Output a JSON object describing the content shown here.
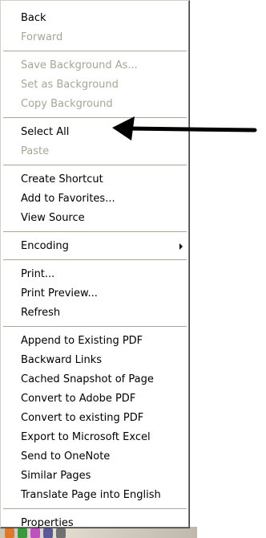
{
  "menu": {
    "groups": [
      [
        {
          "label": "Back",
          "enabled": true
        },
        {
          "label": "Forward",
          "enabled": false
        }
      ],
      [
        {
          "label": "Save Background As...",
          "enabled": false
        },
        {
          "label": "Set as Background",
          "enabled": false
        },
        {
          "label": "Copy Background",
          "enabled": false
        }
      ],
      [
        {
          "label": "Select All",
          "enabled": true
        },
        {
          "label": "Paste",
          "enabled": false
        }
      ],
      [
        {
          "label": "Create Shortcut",
          "enabled": true
        },
        {
          "label": "Add to Favorites...",
          "enabled": true
        },
        {
          "label": "View Source",
          "enabled": true
        }
      ],
      [
        {
          "label": "Encoding",
          "enabled": true,
          "submenu": true
        }
      ],
      [
        {
          "label": "Print...",
          "enabled": true
        },
        {
          "label": "Print Preview...",
          "enabled": true
        },
        {
          "label": "Refresh",
          "enabled": true
        }
      ],
      [
        {
          "label": "Append to Existing PDF",
          "enabled": true
        },
        {
          "label": "Backward Links",
          "enabled": true
        },
        {
          "label": "Cached Snapshot of Page",
          "enabled": true
        },
        {
          "label": "Convert to Adobe PDF",
          "enabled": true
        },
        {
          "label": "Convert to existing PDF",
          "enabled": true
        },
        {
          "label": "Export to Microsoft Excel",
          "enabled": true
        },
        {
          "label": "Send to OneNote",
          "enabled": true
        },
        {
          "label": "Similar Pages",
          "enabled": true
        },
        {
          "label": "Translate Page into English",
          "enabled": true
        }
      ],
      [
        {
          "label": "Properties",
          "enabled": true
        }
      ]
    ]
  },
  "annotation": {
    "icon": "left-arrow-icon",
    "points_to": "Select All"
  },
  "colors": {
    "menu_background": "#ffffff",
    "text": "#000000",
    "disabled_text": "#a8a596",
    "separator": "#aca899",
    "arrow": "#000000"
  }
}
